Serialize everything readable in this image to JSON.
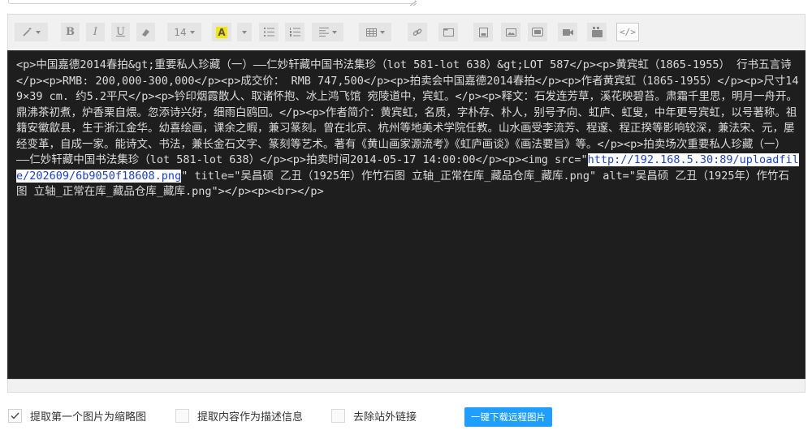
{
  "toolbar": {
    "buttons": [
      {
        "id": "clear-format",
        "label": "",
        "icon": "magic-wand-icon",
        "has_menu": true
      },
      {
        "id": "bold",
        "label": "B",
        "icon": "bold-icon"
      },
      {
        "id": "italic",
        "label": "I",
        "icon": "italic-icon"
      },
      {
        "id": "underline",
        "label": "U",
        "icon": "underline-icon"
      },
      {
        "id": "eraser",
        "label": "",
        "icon": "eraser-icon"
      },
      {
        "id": "font-size",
        "label": "14",
        "icon": "font-size-icon",
        "has_menu": true
      },
      {
        "id": "font-color",
        "label": "A",
        "icon": "font-color-icon"
      },
      {
        "id": "font-color-menu",
        "label": "",
        "icon": "chevron-down-icon"
      },
      {
        "id": "bullet-list",
        "label": "",
        "icon": "bullet-list-icon"
      },
      {
        "id": "ordered-list",
        "label": "",
        "icon": "ordered-list-icon"
      },
      {
        "id": "align",
        "label": "",
        "icon": "align-icon",
        "has_menu": true
      },
      {
        "id": "table",
        "label": "",
        "icon": "table-icon",
        "has_menu": true
      },
      {
        "id": "link",
        "label": "",
        "icon": "link-icon"
      },
      {
        "id": "frame",
        "label": "",
        "icon": "frame-icon"
      },
      {
        "id": "upload-file",
        "label": "",
        "icon": "file-icon"
      },
      {
        "id": "image",
        "label": "",
        "icon": "image-icon"
      },
      {
        "id": "gallery",
        "label": "",
        "icon": "gallery-icon"
      },
      {
        "id": "video",
        "label": "",
        "icon": "video-icon"
      },
      {
        "id": "media",
        "label": "",
        "icon": "media-icon"
      },
      {
        "id": "source-code",
        "label": "</>",
        "icon": "source-code-icon",
        "active": true
      }
    ]
  },
  "editor": {
    "source_before": "<p>中国嘉德2014春拍&gt;重要私人珍藏（一）——仁妙轩藏中国书法集珍（lot 581-lot 638）&gt;LOT 587</p><p>黄宾虹（1865-1955） 行书五言诗</p><p>RMB: 200,000-300,000</p><p>成交价： RMB 747,500</p><p>拍卖会中国嘉德2014春拍</p><p>作者黄宾虹（1865-1955）</p><p>尺寸149×39 cm. 约5.2平尺</p><p>钤印烟霞散人、取诸怀抱、冰上鸿飞馆 宛陵道中，宾虹。</p><p>释文：石发连芳草，溪花映碧苔。肃霜千里思，明月一舟开。鼎沸茶初煮，炉香栗自煨。忽添诗兴好，细雨白鸥回。</p><p>作者简介：黄宾虹，名质，字朴存、朴人，别号予向、虹庐、虹叟，中年更号宾虹，以号著称。祖籍安徽歙县，生于浙江金华。幼喜绘画，课余之暇，兼习篆刻。曾在北京、杭州等地美术学院任教。山水画受李流芳、程邃、程正揆等影响较深，兼法宋、元，屡经变革，自成一家。能诗文、书法，兼长金石文字、篆刻等艺术。著有《黄山画家源流考》《虹庐画谈》《画法要旨》等。</p><p>拍卖场次重要私人珍藏（一）——仁妙轩藏中国书法集珍（lot 581-lot 638）</p><p>拍卖时间2014-05-17 14:00:00</p><p><img src=\"",
    "source_selected": "http://192.168.5.30:89/uploadfile/202609/6b9050f18608.png",
    "source_after": "\" title=\"吴昌硕 乙丑（1925年）作竹石图 立轴_正常在库_藏品仓库_藏库.png\" alt=\"吴昌硕 乙丑（1925年）作竹石图 立轴_正常在库_藏品仓库_藏库.png\"></p><p><br></p>"
  },
  "options": [
    {
      "label": "提取第一个图片为缩略图",
      "checked": true
    },
    {
      "label": "提取内容作为描述信息",
      "checked": false
    },
    {
      "label": "去除站外链接",
      "checked": false
    }
  ],
  "download_button": {
    "label": "一键下载远程图片"
  },
  "colors": {
    "accent": "#1e9fff",
    "editor_bg": "#1e1e1e",
    "toolbar_bg": "#f1f1f1",
    "font_color_swatch": "#f5e60a"
  }
}
